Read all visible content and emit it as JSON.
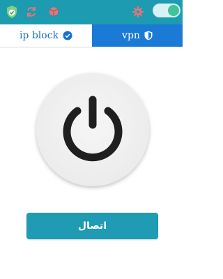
{
  "topbar": {
    "background": "#1d9bb0",
    "icons": [
      "shield-check-icon",
      "refresh-icon",
      "box-icon",
      "gear-icon"
    ],
    "toggle": {
      "state": "on",
      "knob_color": "#3fc39a"
    }
  },
  "tabs": [
    {
      "label": "ip block",
      "icon": "check-circle-icon",
      "active": false
    },
    {
      "label": "vpn",
      "icon": "shield-icon",
      "active": true
    }
  ],
  "power": {
    "icon": "power-icon"
  },
  "connect_button": {
    "label": "اتصال",
    "color": "#1f9bb3"
  }
}
